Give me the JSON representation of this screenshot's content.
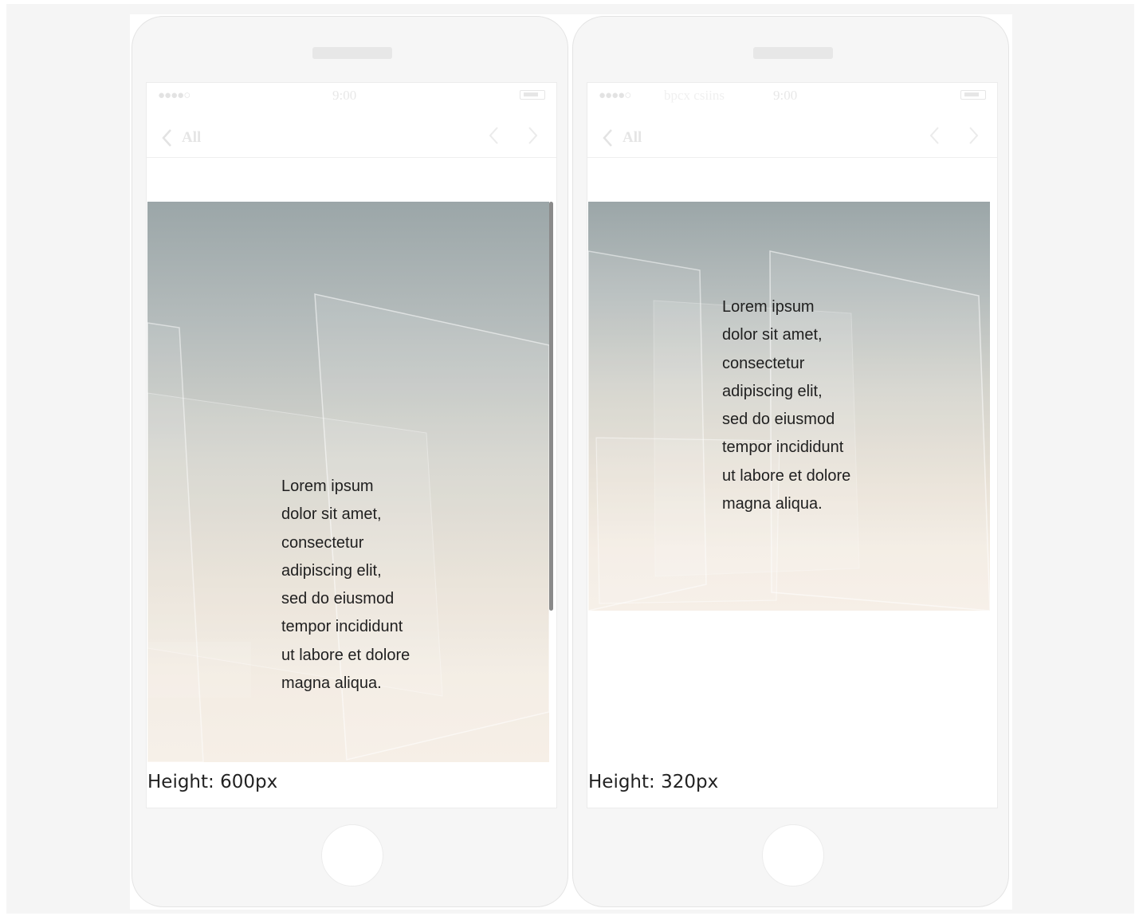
{
  "phones": [
    {
      "status_bar": {
        "signal": "●●●●○",
        "carrier": "",
        "time": "9:00"
      },
      "nav": {
        "back_label": "All"
      },
      "hero": {
        "text": "Lorem ipsum\ndolor sit amet,\nconsectetur\nadipiscing elit,\nsed do eiusmod\ntempor incididunt\nut labore et dolore\nmagna aliqua."
      },
      "height_label": "Height: 600px"
    },
    {
      "status_bar": {
        "signal": "●●●●○",
        "carrier": "bpcx csiins",
        "time": "9:00"
      },
      "nav": {
        "back_label": "All"
      },
      "hero": {
        "text": "Lorem ipsum\ndolor sit amet,\nconsectetur\nadipiscing elit,\nsed do eiusmod\ntempor incididunt\nut labore et dolore\nmagna aliqua."
      },
      "height_label": "Height: 320px"
    }
  ],
  "colors": {
    "phone_body": "#f6f6f6",
    "screen": "#ffffff",
    "chrome_text": "#e6e6e6",
    "hero_top": "#9ba6a8",
    "hero_bottom": "#f6efe7",
    "scrollbar": "#8a8a8a"
  },
  "icons": {
    "back": "chevron-left-icon",
    "prev": "chevron-left-icon",
    "next": "chevron-right-icon",
    "battery": "battery-icon"
  }
}
